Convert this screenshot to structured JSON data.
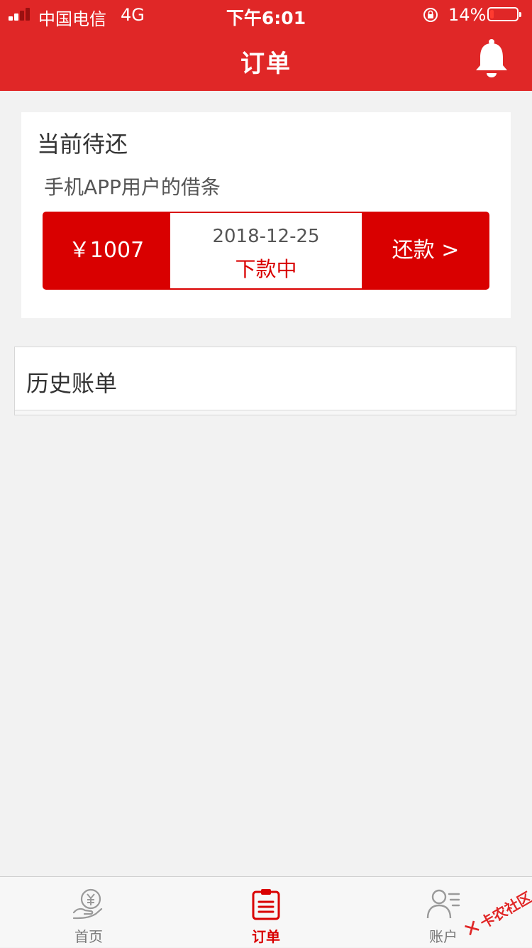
{
  "status_bar": {
    "carrier": "中国电信",
    "network": "4G",
    "time": "下午6:01",
    "battery_percent": "14%",
    "battery_level": 0.14
  },
  "nav": {
    "title": "订单",
    "right_icon": "bell-icon"
  },
  "current": {
    "title": "当前待还",
    "loan_name": "手机APP用户的借条",
    "amount": "￥1007",
    "due_date": "2018-12-25",
    "status": "下款中",
    "repay_label": "还款 >"
  },
  "history": {
    "title": "历史账单"
  },
  "tabbar": {
    "items": [
      {
        "label": "首页",
        "icon": "yuan-hand-icon",
        "active": false
      },
      {
        "label": "订单",
        "icon": "clipboard-icon",
        "active": true
      },
      {
        "label": "账户",
        "icon": "user-list-icon",
        "active": false
      }
    ]
  },
  "watermark": {
    "text": "卡农社区",
    "mark": "✕"
  },
  "colors": {
    "header": "#e02727",
    "accent": "#d90000",
    "background": "#f2f2f2"
  }
}
